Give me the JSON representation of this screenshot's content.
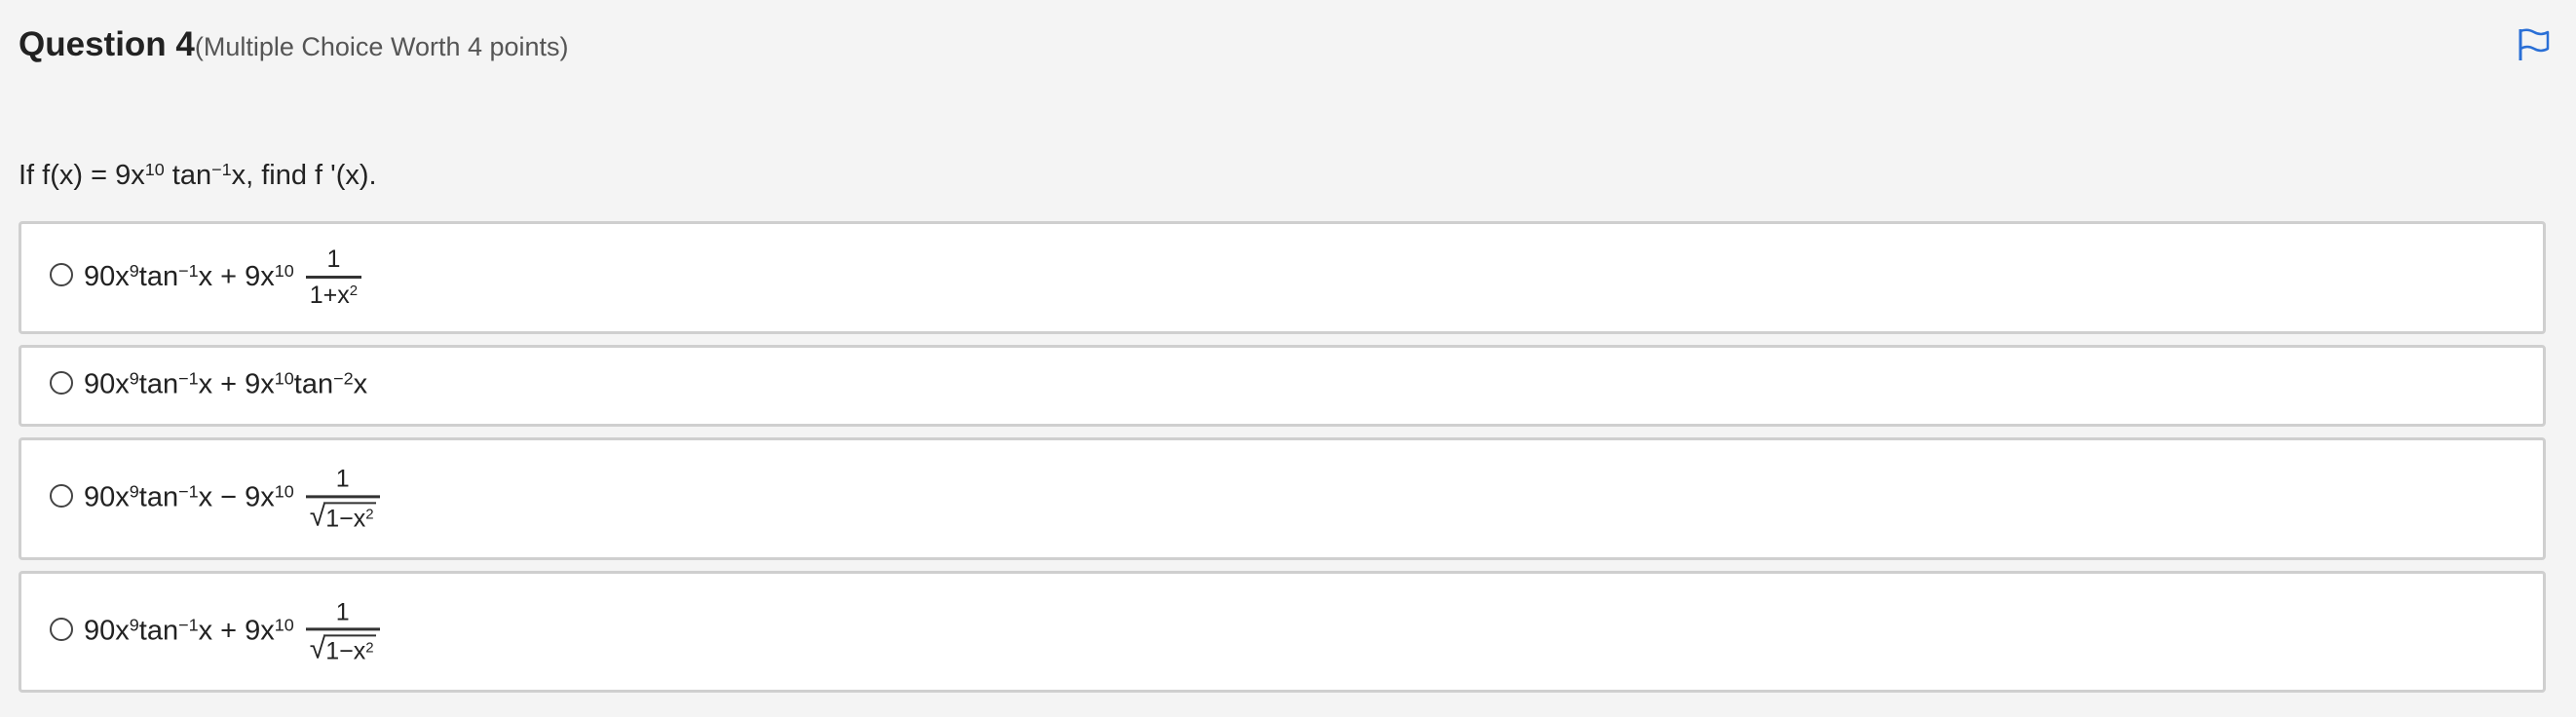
{
  "question": {
    "title": "Question 4",
    "worth": "(Multiple Choice Worth 4 points)",
    "prompt": {
      "pre": "If f(x) = 9x",
      "exp1": "10",
      "mid": " tan",
      "exp2": "−1",
      "post": "x, find f '(x)."
    }
  },
  "flag": {
    "icon": "flag-icon",
    "color": "#2a6fd6"
  },
  "options": [
    {
      "t1": "90x",
      "e1": "9",
      "t2": "tan",
      "e2": "−1",
      "t3": "x + 9x",
      "e3": "10",
      "num": "1",
      "den_a": "1+x",
      "den_exp": "2"
    },
    {
      "t1": "90x",
      "e1": "9",
      "t2": "tan",
      "e2": "−1",
      "t3": "x + 9x",
      "e3": "10",
      "t4": "tan",
      "e4": "−2",
      "t5": "x"
    },
    {
      "t1": "90x",
      "e1": "9",
      "t2": "tan",
      "e2": "−1",
      "t3": "x − 9x",
      "e3": "10",
      "num": "1",
      "rad": "√",
      "den_a": "1−x",
      "den_exp": "2"
    },
    {
      "t1": "90x",
      "e1": "9",
      "t2": "tan",
      "e2": "−1",
      "t3": "x + 9x",
      "e3": "10",
      "num": "1",
      "rad": "√",
      "den_a": "1−x",
      "den_exp": "2"
    }
  ]
}
